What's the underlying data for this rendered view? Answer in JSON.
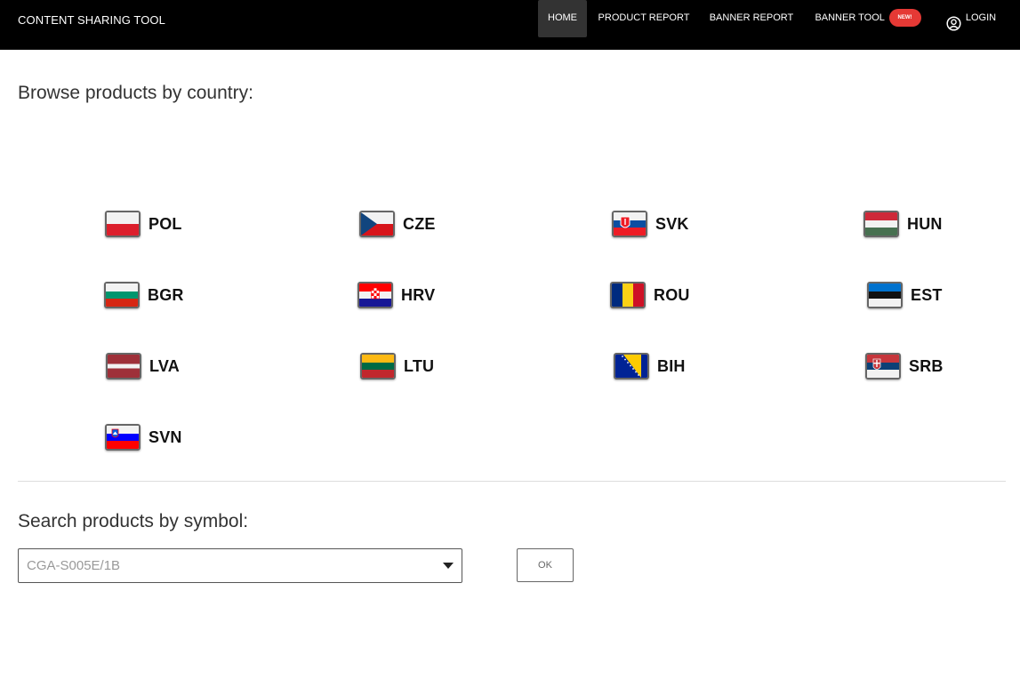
{
  "navbar": {
    "brand": "CONTENT SHARING TOOL",
    "items": [
      {
        "label": "HOME",
        "active": true
      },
      {
        "label": "PRODUCT REPORT",
        "active": false
      },
      {
        "label": "BANNER REPORT",
        "active": false
      },
      {
        "label": "BANNER TOOL",
        "active": false,
        "badge": "NEW!"
      },
      {
        "label": "LOGIN",
        "active": false,
        "icon": "user-circle-icon"
      }
    ]
  },
  "browse": {
    "heading": "Browse products by country:",
    "countries": [
      {
        "code": "POL",
        "flag": "poland-flag-icon"
      },
      {
        "code": "CZE",
        "flag": "czechia-flag-icon"
      },
      {
        "code": "SVK",
        "flag": "slovakia-flag-icon"
      },
      {
        "code": "HUN",
        "flag": "hungary-flag-icon"
      },
      {
        "code": "BGR",
        "flag": "bulgaria-flag-icon"
      },
      {
        "code": "HRV",
        "flag": "croatia-flag-icon"
      },
      {
        "code": "ROU",
        "flag": "romania-flag-icon"
      },
      {
        "code": "EST",
        "flag": "estonia-flag-icon"
      },
      {
        "code": "LVA",
        "flag": "latvia-flag-icon"
      },
      {
        "code": "LTU",
        "flag": "lithuania-flag-icon"
      },
      {
        "code": "BIH",
        "flag": "bosnia-flag-icon"
      },
      {
        "code": "SRB",
        "flag": "serbia-flag-icon"
      },
      {
        "code": "SVN",
        "flag": "slovenia-flag-icon"
      }
    ]
  },
  "search": {
    "heading": "Search products by symbol:",
    "selected_value": "CGA-S005E/1B",
    "button_label": "OK"
  },
  "colors": {
    "navbar_bg": "#000000",
    "active_nav_bg": "#333333",
    "badge_bg": "#e53935"
  }
}
